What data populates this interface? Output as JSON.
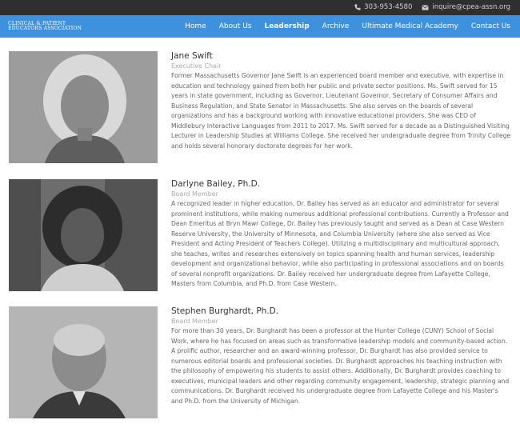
{
  "topbar": {
    "phone": "303-953-4580",
    "email": "inquire@cpea-assn.org"
  },
  "logo": {
    "line1": "CLINICAL & PATIENT",
    "line2": "EDUCATORS ASSOCIATION"
  },
  "nav": [
    {
      "label": "Home"
    },
    {
      "label": "About Us"
    },
    {
      "label": "Leadership"
    },
    {
      "label": "Archive"
    },
    {
      "label": "Ultimate Medical Academy"
    },
    {
      "label": "Contact Us"
    }
  ],
  "colors": {
    "nav_bg": "#3d91dd",
    "topbar_bg": "#2f2f2f"
  },
  "bios": [
    {
      "name": "Jane Swift",
      "role": "Executive Chair",
      "text": "Former Massachusetts Governor Jane Swift is an experienced board member and executive, with expertise in education and technology gained from both her public and private sector positions. Ms. Swift served for 15 years in state government, including as Governor, Lieutenant Governor, Secretary of Consumer Affairs and Business Regulation, and State Senator in Massachusetts. She also serves on the boards of several organizations and has a background working with innovative educational providers. She was CEO of Middlebury Interactive Languages from 2011 to 2017. Ms. Swift served for a decade as a Distinguished Visiting Lecturer in Leadership Studies at Williams College. She received her undergraduate degree from Trinity College and holds several honorary doctorate degrees for her work."
    },
    {
      "name": "Darlyne Bailey, Ph.D.",
      "role": "Board Member",
      "text": "A recognized leader in higher education, Dr. Bailey has served as an educator and administrator for several prominent institutions, while making numerous additional professional contributions. Currently a Professor and Dean Emeritus at Bryn Mawr College, Dr. Bailey has previously taught and served as a Dean at Case Western Reserve University, the University of Minnesota, and Columbia University (where she also served as Vice President and Acting President of Teachers College). Utilizing a multidisciplinary and multicultural approach, she teaches, writes and researches extensively on topics spanning health and human services, leadership development and organizational behavior, while also participating in professional associations and on boards of several nonprofit organizations. Dr. Bailey received her undergraduate degree from Lafayette College, Masters from Columbia, and Ph.D. from Case Western."
    },
    {
      "name": "Stephen Burghardt, Ph.D.",
      "role": "Board Member",
      "text": "For more than 30 years, Dr. Burghardt has been a professor at the Hunter College (CUNY) School of Social Work, where he has focused on areas such as transformative leadership models and community-based action. A prolific author, researcher and an award-winning professor, Dr. Burghardt has also provided service to numerous editorial boards and professional societies. Dr. Burghardt approaches his teaching instruction with the philosophy of empowering his students to assist others. Additionally, Dr. Burghardt provides coaching to executives, municipal leaders and other regarding community engagement, leadership, strategic planning and communications. Dr. Burghardt received his undergraduate degree from Lafayette College and his Master's and Ph.D. from the University of Michigan."
    }
  ]
}
